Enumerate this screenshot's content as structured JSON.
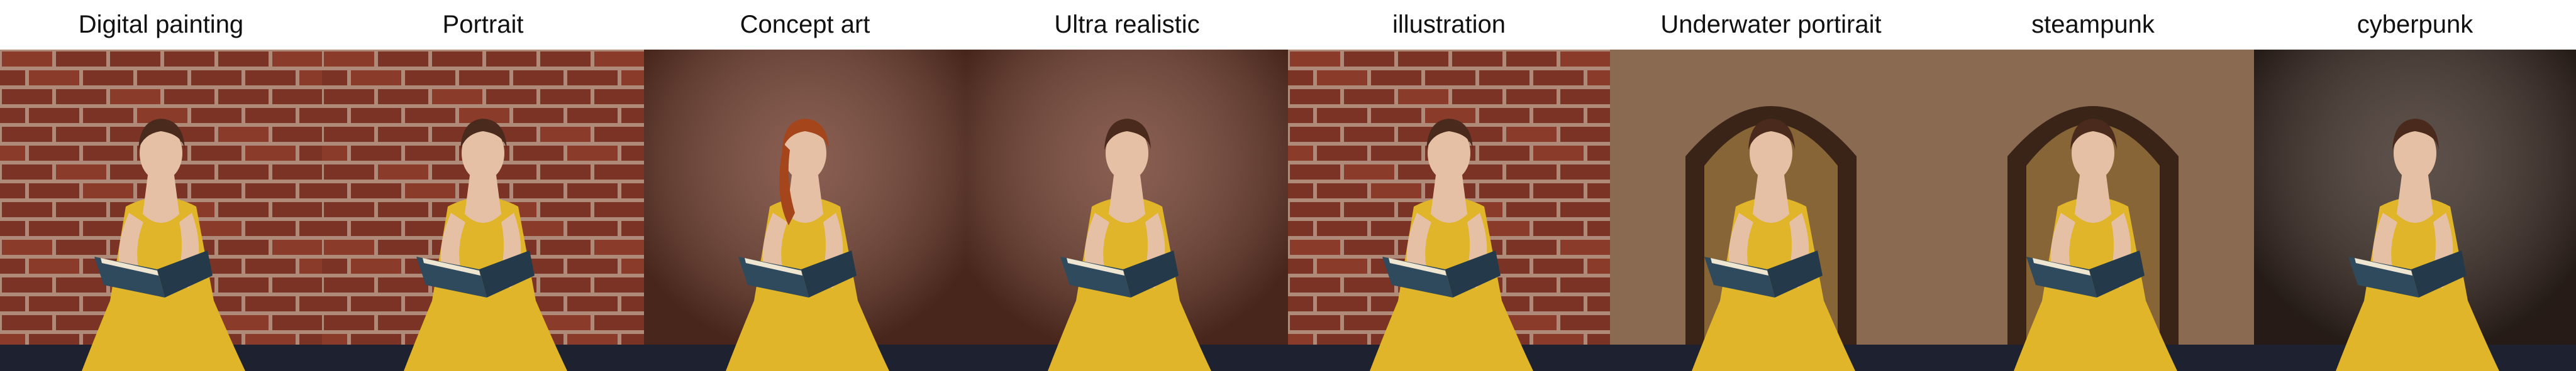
{
  "panels": [
    {
      "label": "Digital painting",
      "style": "brick"
    },
    {
      "label": "Portrait",
      "style": "brick"
    },
    {
      "label": "Concept art",
      "style": "plain"
    },
    {
      "label": "Ultra realistic",
      "style": "plain"
    },
    {
      "label": "illustration",
      "style": "brick"
    },
    {
      "label": "Underwater portirait",
      "style": "arch"
    },
    {
      "label": "steampunk",
      "style": "arch"
    },
    {
      "label": "cyberpunk",
      "style": "dark"
    }
  ],
  "colors": {
    "brick": "#7a3324",
    "mortar": "#b08a78",
    "wall_plain": "#6e3a2a",
    "stone": "#8a6a50",
    "dark_wall": "#3a2a22",
    "dress": "#e0b52a",
    "skin": "#e6c0a4",
    "hair": "#4a2a1c",
    "hair_red": "#a4451c",
    "book": "#2f4a5c",
    "floor": "#1e2230"
  }
}
